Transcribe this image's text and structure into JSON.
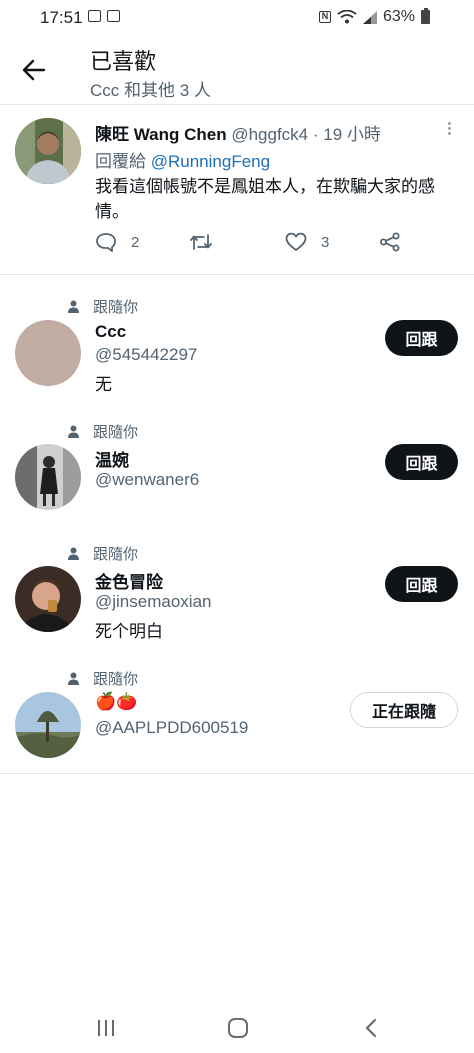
{
  "status": {
    "time": "17:51",
    "battery": "63%"
  },
  "header": {
    "title": "已喜歡",
    "subtitle": "Ccc 和其他 3 人"
  },
  "tweet": {
    "name": "陳旺 Wang Chen",
    "meta": "@hggfck4 · 19 小時",
    "reply_prefix": "回覆給",
    "reply_to": "@RunningFeng",
    "text": "我看這個帳號不是鳳姐本人，在欺騙大家的感情。",
    "replies": "2",
    "likes": "3"
  },
  "users": [
    {
      "follows_label": "跟隨你",
      "name": "Ccc",
      "handle": "@545442297",
      "bio": "无",
      "button": "回跟"
    },
    {
      "follows_label": "跟隨你",
      "name": "温婉",
      "handle": "@wenwaner6",
      "bio": "",
      "button": "回跟"
    },
    {
      "follows_label": "跟隨你",
      "name": "金色冒险",
      "handle": "@jinsemaoxian",
      "bio": "死个明白",
      "button": "回跟"
    },
    {
      "follows_label": "跟隨你",
      "name": "🍎🍅",
      "handle": "@AAPLPDD600519",
      "bio": "",
      "button": "正在跟隨"
    }
  ]
}
